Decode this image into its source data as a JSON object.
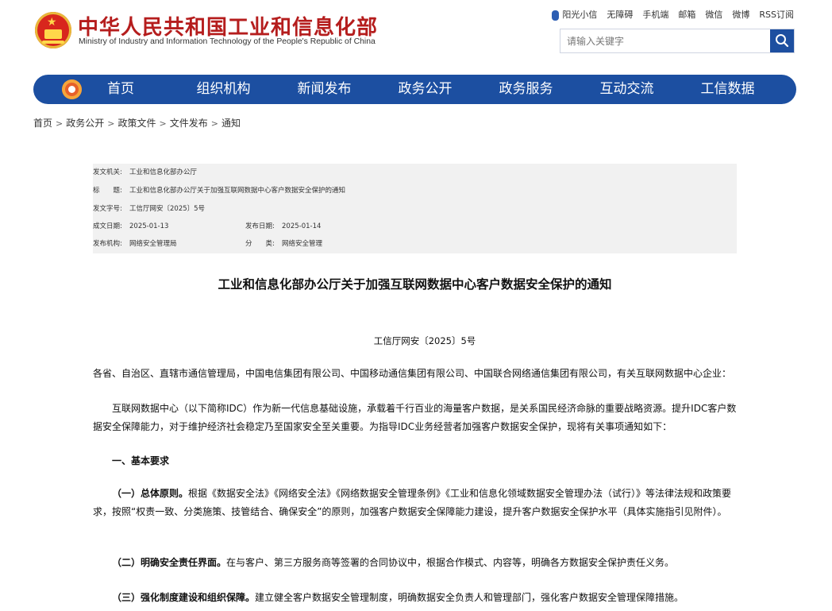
{
  "header": {
    "title_cn": "中华人民共和国工业和信息化部",
    "title_en": "Ministry of Industry and Information Technology of the People's Republic of China",
    "toplinks": [
      "阳光小信",
      "无障碍",
      "手机端",
      "邮箱",
      "微信",
      "微博",
      "RSS订阅"
    ],
    "search_placeholder": "请输入关键字"
  },
  "nav": {
    "items": [
      "首页",
      "组织机构",
      "新闻发布",
      "政务公开",
      "政务服务",
      "互动交流",
      "工信数据"
    ]
  },
  "breadcrumb": [
    "首页",
    "政务公开",
    "政策文件",
    "文件发布",
    "通知"
  ],
  "meta": {
    "issuer_label": "发文机关:",
    "issuer": "工业和信息化部办公厅",
    "title_label": "标　　题:",
    "title": "工业和信息化部办公厅关于加强互联网数据中心客户数据安全保护的通知",
    "docno_label": "发文字号:",
    "docno": "工信厅网安〔2025〕5号",
    "created_label": "成文日期:",
    "created": "2025-01-13",
    "published_label": "发布日期:",
    "published": "2025-01-14",
    "org_label": "发布机构:",
    "org": "网络安全管理局",
    "category_label": "分　　类:",
    "category": "网络安全管理"
  },
  "document": {
    "title": "工业和信息化部办公厅关于加强互联网数据中心客户数据安全保护的通知",
    "number": "工信厅网安〔2025〕5号",
    "recipients": "各省、自治区、直辖市通信管理局，中国电信集团有限公司、中国移动通信集团有限公司、中国联合网络通信集团有限公司，有关互联网数据中心企业：",
    "intro": "互联网数据中心（以下简称IDC）作为新一代信息基础设施，承载着千行百业的海量客户数据，是关系国民经济命脉的重要战略资源。提升IDC客户数据安全保障能力，对于维护经济社会稳定乃至国家安全至关重要。为指导IDC业务经营者加强客户数据安全保护，现将有关事项通知如下：",
    "section1": "一、基本要求",
    "item1_head": "（一）总体原则。",
    "item1_body": "根据《数据安全法》《网络安全法》《网络数据安全管理条例》《工业和信息化领域数据安全管理办法（试行）》等法律法规和政策要求，按照“权责一致、分类施策、技管结合、确保安全”的原则，加强客户数据安全保障能力建设，提升客户数据安全保护水平（具体实施指引见附件）。",
    "item2_head": "（二）明确安全责任界面。",
    "item2_body": "在与客户、第三方服务商等签署的合同协议中，根据合作模式、内容等，明确各方数据安全保护责任义务。",
    "item3_head": "（三）强化制度建设和组织保障。",
    "item3_body": "建立健全客户数据安全管理制度，明确数据安全负责人和管理部门，强化客户数据安全管理保障措施。"
  }
}
